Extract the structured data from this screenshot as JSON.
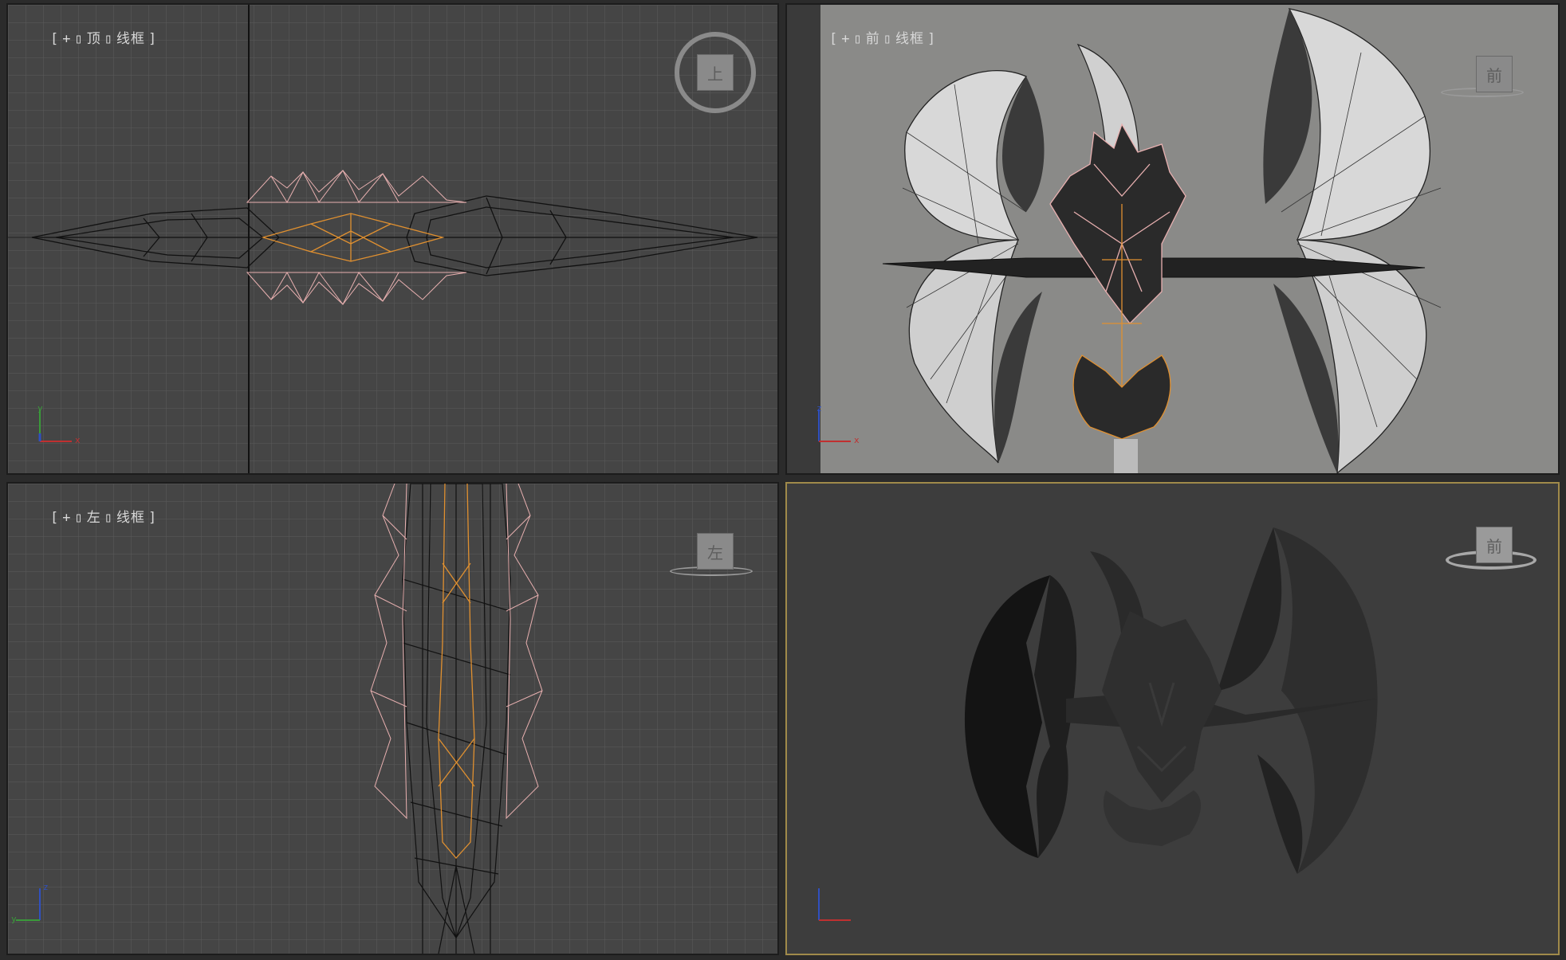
{
  "viewports": {
    "top": {
      "label_parts": [
        "[",
        "+",
        "▯",
        "顶",
        "▯",
        "线框",
        "]"
      ],
      "cube_label": "上"
    },
    "front": {
      "label_parts": [
        "[",
        "+",
        "▯",
        "前",
        "▯",
        "线框",
        "]"
      ],
      "cube_label": "前"
    },
    "left": {
      "label_parts": [
        "[",
        "+",
        "▯",
        "左",
        "▯",
        "线框",
        "]"
      ],
      "cube_label": "左"
    },
    "perspective": {
      "cube_label": "前"
    }
  },
  "axes": {
    "top": {
      "v": "y",
      "h": "x"
    },
    "front": {
      "v": "z",
      "h": "x"
    },
    "left": {
      "v": "z",
      "h": "y"
    }
  },
  "colors": {
    "grid_bg": "#454545",
    "grid_line": "#5a5a5a",
    "wire_black": "#111111",
    "wire_pink": "#e8b0b0",
    "wire_orange": "#e09030",
    "active_border": "#a08a4a"
  }
}
